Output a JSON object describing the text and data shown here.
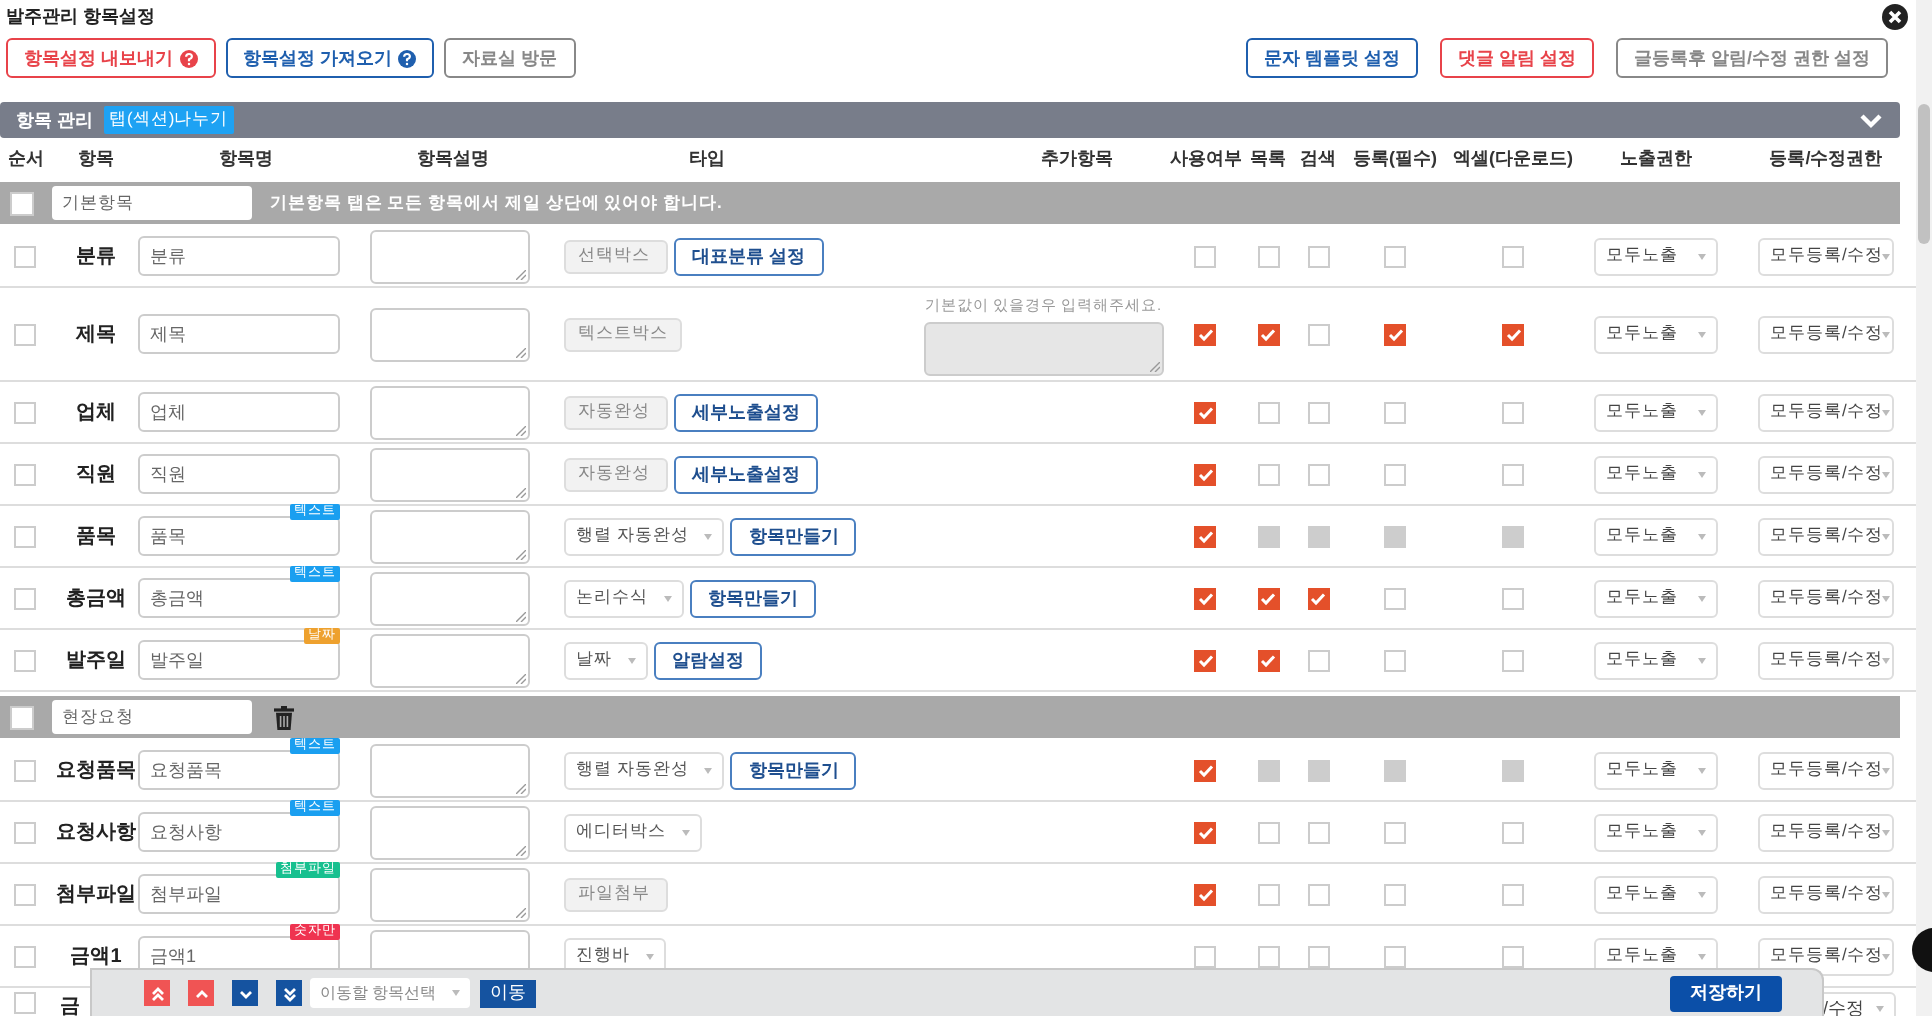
{
  "window": {
    "title": "발주관리 항목설정"
  },
  "toolbar": {
    "left": [
      {
        "label": "항목설정 내보내기",
        "color": "#e8434a",
        "help": true
      },
      {
        "label": "항목설정 가져오기",
        "color": "#1f5fae",
        "help": true
      },
      {
        "label": "자료실 방문",
        "color": "#888888",
        "help": false
      }
    ],
    "right": [
      {
        "label": "문자 템플릿 설정",
        "color": "#1f5fae"
      },
      {
        "label": "댓글 알림 설정",
        "color": "#e8434a"
      },
      {
        "label": "글등록후 알림/수정 권한 설정",
        "color": "#888888"
      }
    ]
  },
  "panel": {
    "title": "항목 관리",
    "tag": "탭(섹션)나누기",
    "expanded": true
  },
  "table": {
    "columns": [
      "순서",
      "항목",
      "항목명",
      "항목설명",
      "타입",
      "추가항목",
      "사용여부",
      "목록",
      "검색",
      "등록(필수)",
      "엑셀(다운로드)",
      "노출권한",
      "등록/수정권한"
    ],
    "rows": [
      {
        "kind": "section",
        "selected": false,
        "name": "기본항목",
        "note": "기본항목 탭은 모든 항목에서 제일 상단에 있어야 합니다.",
        "deletable": false
      },
      {
        "kind": "item",
        "selected": false,
        "label": "분류",
        "name": "분류",
        "type": {
          "text": "선택박스",
          "editable": false
        },
        "action": "대표분류 설정",
        "checks": [
          {
            "checked": false,
            "disabled": false
          },
          {
            "checked": false,
            "disabled": false
          },
          {
            "checked": false,
            "disabled": false
          },
          {
            "checked": false,
            "disabled": false
          },
          {
            "checked": false,
            "disabled": false
          }
        ],
        "visibility": "모두노출",
        "permission": "모두등록/수정"
      },
      {
        "kind": "item",
        "selected": false,
        "label": "제목",
        "name": "제목",
        "type": {
          "text": "텍스트박스",
          "editable": false
        },
        "extra_hint": "기본값이 있을경우 입력해주세요.",
        "checks": [
          {
            "checked": true,
            "disabled": false
          },
          {
            "checked": true,
            "disabled": false
          },
          {
            "checked": false,
            "disabled": false
          },
          {
            "checked": true,
            "disabled": false
          },
          {
            "checked": true,
            "disabled": false
          }
        ],
        "visibility": "모두노출",
        "permission": "모두등록/수정"
      },
      {
        "kind": "item",
        "selected": false,
        "label": "업체",
        "name": "업체",
        "type": {
          "text": "자동완성",
          "editable": false
        },
        "action": "세부노출설정",
        "checks": [
          {
            "checked": true,
            "disabled": false
          },
          {
            "checked": false,
            "disabled": false
          },
          {
            "checked": false,
            "disabled": false
          },
          {
            "checked": false,
            "disabled": false
          },
          {
            "checked": false,
            "disabled": false
          }
        ],
        "visibility": "모두노출",
        "permission": "모두등록/수정"
      },
      {
        "kind": "item",
        "selected": false,
        "label": "직원",
        "name": "직원",
        "type": {
          "text": "자동완성",
          "editable": false
        },
        "action": "세부노출설정",
        "checks": [
          {
            "checked": true,
            "disabled": false
          },
          {
            "checked": false,
            "disabled": false
          },
          {
            "checked": false,
            "disabled": false
          },
          {
            "checked": false,
            "disabled": false
          },
          {
            "checked": false,
            "disabled": false
          }
        ],
        "visibility": "모두노출",
        "permission": "모두등록/수정"
      },
      {
        "kind": "item",
        "selected": false,
        "label": "품목",
        "name": "품목",
        "badge": {
          "text": "텍스트",
          "color": "#1a9ff0"
        },
        "type": {
          "text": "행렬 자동완성",
          "editable": true
        },
        "action": "항목만들기",
        "checks": [
          {
            "checked": true,
            "disabled": false
          },
          {
            "checked": false,
            "disabled": true
          },
          {
            "checked": false,
            "disabled": true
          },
          {
            "checked": false,
            "disabled": true
          },
          {
            "checked": false,
            "disabled": true
          }
        ],
        "visibility": "모두노출",
        "permission": "모두등록/수정"
      },
      {
        "kind": "item",
        "selected": false,
        "label": "총금액",
        "name": "총금액",
        "badge": {
          "text": "텍스트",
          "color": "#1a9ff0"
        },
        "type": {
          "text": "논리수식",
          "editable": true
        },
        "action": "항목만들기",
        "checks": [
          {
            "checked": true,
            "disabled": false
          },
          {
            "checked": true,
            "disabled": false
          },
          {
            "checked": true,
            "disabled": false
          },
          {
            "checked": false,
            "disabled": false
          },
          {
            "checked": false,
            "disabled": false
          }
        ],
        "visibility": "모두노출",
        "permission": "모두등록/수정"
      },
      {
        "kind": "item",
        "selected": false,
        "label": "발주일",
        "name": "발주일",
        "badge": {
          "text": "날짜",
          "color": "#eea12e"
        },
        "type": {
          "text": "날짜",
          "editable": true
        },
        "action": "알람설정",
        "checks": [
          {
            "checked": true,
            "disabled": false
          },
          {
            "checked": true,
            "disabled": false
          },
          {
            "checked": false,
            "disabled": false
          },
          {
            "checked": false,
            "disabled": false
          },
          {
            "checked": false,
            "disabled": false
          }
        ],
        "visibility": "모두노출",
        "permission": "모두등록/수정"
      },
      {
        "kind": "section",
        "selected": false,
        "name": "현장요청",
        "deletable": true
      },
      {
        "kind": "item",
        "selected": false,
        "label": "요청품목",
        "name": "요청품목",
        "badge": {
          "text": "텍스트",
          "color": "#1a9ff0"
        },
        "type": {
          "text": "행렬 자동완성",
          "editable": true
        },
        "action": "항목만들기",
        "checks": [
          {
            "checked": true,
            "disabled": false
          },
          {
            "checked": false,
            "disabled": true
          },
          {
            "checked": false,
            "disabled": true
          },
          {
            "checked": false,
            "disabled": true
          },
          {
            "checked": false,
            "disabled": true
          }
        ],
        "visibility": "모두노출",
        "permission": "모두등록/수정"
      },
      {
        "kind": "item",
        "selected": false,
        "label": "요청사항",
        "name": "요청사항",
        "badge": {
          "text": "텍스트",
          "color": "#1a9ff0"
        },
        "type": {
          "text": "에디터박스",
          "editable": true
        },
        "checks": [
          {
            "checked": true,
            "disabled": false
          },
          {
            "checked": false,
            "disabled": false
          },
          {
            "checked": false,
            "disabled": false
          },
          {
            "checked": false,
            "disabled": false
          },
          {
            "checked": false,
            "disabled": false
          }
        ],
        "visibility": "모두노출",
        "permission": "모두등록/수정"
      },
      {
        "kind": "item",
        "selected": false,
        "label": "첨부파일",
        "name": "첨부파일",
        "badge": {
          "text": "첨부파일",
          "color": "#17c08f"
        },
        "type": {
          "text": "파일첨부",
          "editable": false
        },
        "checks": [
          {
            "checked": true,
            "disabled": false
          },
          {
            "checked": false,
            "disabled": false
          },
          {
            "checked": false,
            "disabled": false
          },
          {
            "checked": false,
            "disabled": false
          },
          {
            "checked": false,
            "disabled": false
          }
        ],
        "visibility": "모두노출",
        "permission": "모두등록/수정"
      },
      {
        "kind": "item",
        "selected": false,
        "label": "금액1",
        "name": "금액1",
        "badge": {
          "text": "숫자만",
          "color": "#ef3350"
        },
        "type": {
          "text": "진행바",
          "editable": true
        },
        "checks": [
          {
            "checked": false,
            "disabled": false
          },
          {
            "checked": false,
            "disabled": false
          },
          {
            "checked": false,
            "disabled": false
          },
          {
            "checked": false,
            "disabled": false
          },
          {
            "checked": false,
            "disabled": false
          }
        ],
        "visibility": "모두노출",
        "permission": "모두등록/수정"
      },
      {
        "kind": "partial",
        "selected": false,
        "label": "금",
        "permission": "/수정"
      }
    ]
  },
  "bottom_bar": {
    "move_select": {
      "placeholder": "이동할 항목선택"
    },
    "move_button": "이동",
    "save_button": "저장하기"
  }
}
